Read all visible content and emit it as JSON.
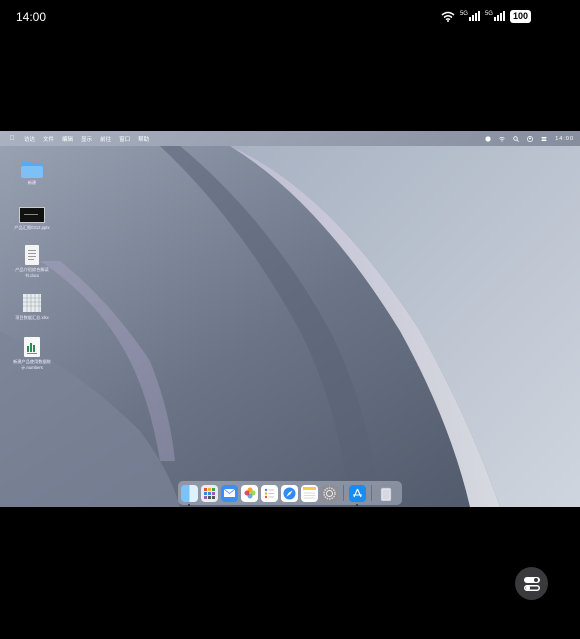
{
  "phone": {
    "time": "14:00",
    "network1": "5G",
    "network2": "5G",
    "battery": "100"
  },
  "menubar": {
    "apple_icon": "apple-logo-icon",
    "items": [
      "访达",
      "文件",
      "编辑",
      "显示",
      "前往",
      "窗口",
      "帮助"
    ],
    "clock": "14:00",
    "right_icons": [
      "focus-icon",
      "wifi-icon",
      "search-icon",
      "user-icon",
      "control-center-icon"
    ]
  },
  "desktop": {
    "items": [
      {
        "label": "新建",
        "icon": "folder-icon"
      },
      {
        "label": "产品汇报0312.pptx",
        "icon": "pptx-icon"
      },
      {
        "label": "产品介绍综合解读\n书.docx",
        "icon": "docx-icon"
      },
      {
        "label": "项目数据汇总.xlsx",
        "icon": "xlsx-icon"
      },
      {
        "label": "新建产品使用数据统\n计.numbers",
        "icon": "numbers-icon"
      }
    ]
  },
  "dock": {
    "apps": [
      "finder-icon",
      "launchpad-icon",
      "mail-icon",
      "photos-icon",
      "reminders-icon",
      "safari-icon",
      "notes-icon",
      "settings-icon",
      "app-store-icon",
      "trash-icon"
    ]
  },
  "colors": {
    "menubar_bg": "#8a93a4",
    "dock_bg": "#c8cdd6",
    "float_button": "#3a3a3c"
  }
}
